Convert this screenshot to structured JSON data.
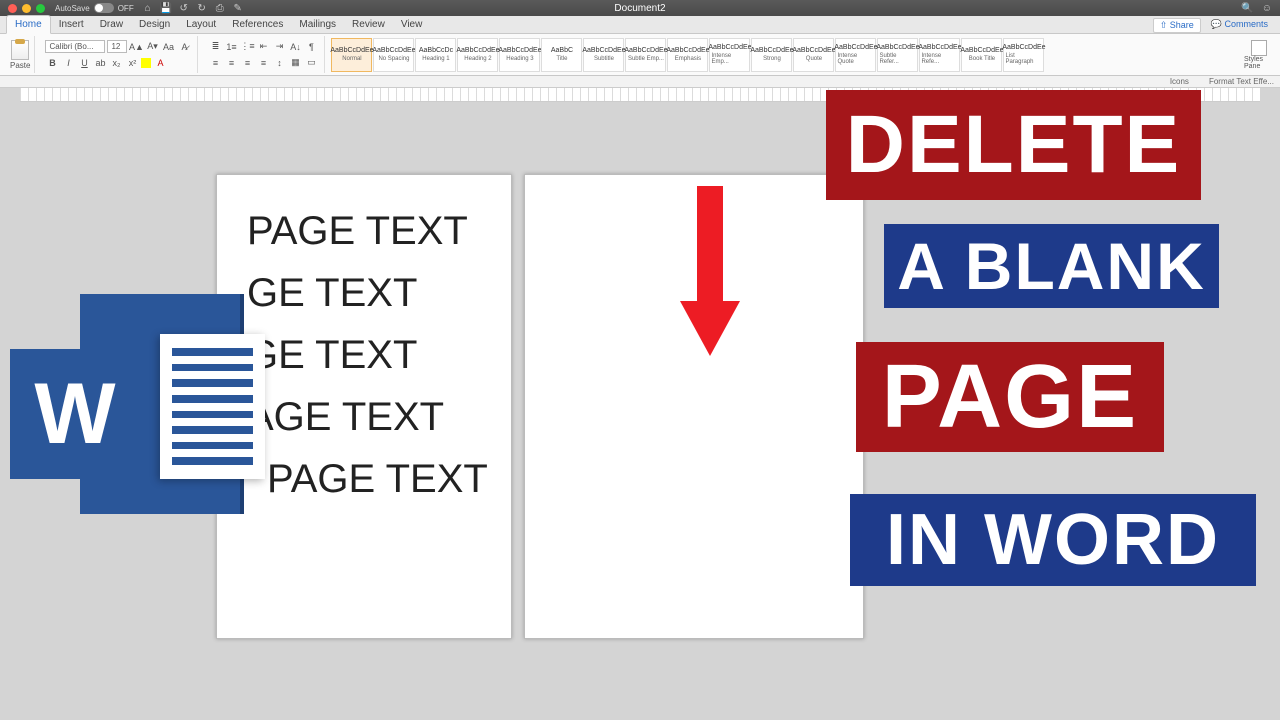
{
  "titlebar": {
    "autosave_label": "AutoSave",
    "autosave_state": "OFF",
    "doc_title": "Document2"
  },
  "qat_icons": [
    "home-icon",
    "save-icon",
    "undo-icon",
    "redo-icon",
    "print-icon",
    "brush-icon"
  ],
  "tabs": [
    "Home",
    "Insert",
    "Draw",
    "Design",
    "Layout",
    "References",
    "Mailings",
    "Review",
    "View"
  ],
  "tabs_right": {
    "share": "Share",
    "comments": "Comments"
  },
  "ribbon": {
    "paste_label": "Paste",
    "font_name": "Calibri (Bo...",
    "font_size": "12",
    "bold": "B",
    "italic": "I",
    "underline": "U",
    "strike": "ab",
    "sub": "x₂",
    "sup": "x²",
    "styles": [
      {
        "preview": "AaBbCcDdEe",
        "label": "Normal",
        "selected": true
      },
      {
        "preview": "AaBbCcDdEe",
        "label": "No Spacing"
      },
      {
        "preview": "AaBbCcDc",
        "label": "Heading 1"
      },
      {
        "preview": "AaBbCcDdEe",
        "label": "Heading 2"
      },
      {
        "preview": "AaBbCcDdEe",
        "label": "Heading 3"
      },
      {
        "preview": "AaBbC",
        "label": "Title"
      },
      {
        "preview": "AaBbCcDdEe",
        "label": "Subtitle"
      },
      {
        "preview": "AaBbCcDdEe",
        "label": "Subtle Emp..."
      },
      {
        "preview": "AaBbCcDdEe",
        "label": "Emphasis"
      },
      {
        "preview": "AaBbCcDdEe",
        "label": "Intense Emp..."
      },
      {
        "preview": "AaBbCcDdEe",
        "label": "Strong"
      },
      {
        "preview": "AaBbCcDdEe",
        "label": "Quote"
      },
      {
        "preview": "AaBbCcDdEe",
        "label": "Intense Quote"
      },
      {
        "preview": "AaBbCcDdEe",
        "label": "Subtle Refer..."
      },
      {
        "preview": "AaBbCcDdEe",
        "label": "Intense Refe..."
      },
      {
        "preview": "AaBbCcDdEe",
        "label": "Book Title"
      },
      {
        "preview": "AaBbCcDdEe",
        "label": "List Paragraph"
      }
    ],
    "styles_pane": "Styles Pane"
  },
  "subrow": {
    "icons": "Icons",
    "format": "Format Text Effe..."
  },
  "page_text_lines": [
    "PAGE TEXT",
    "GE TEXT",
    "GE TEXT",
    "AGE TEXT",
    "PAGE TEXT"
  ],
  "word_logo_letter": "W",
  "overlay": {
    "line1": "DELETE",
    "line2": "A BLANK",
    "line3": "PAGE",
    "line4": "IN WORD"
  }
}
